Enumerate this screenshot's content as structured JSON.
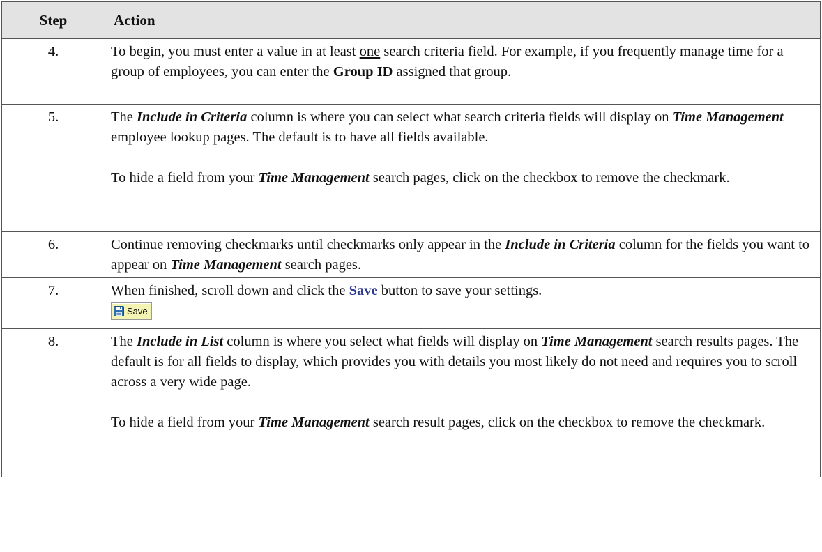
{
  "table": {
    "headers": {
      "step": "Step",
      "action": "Action"
    },
    "rows": [
      {
        "step": "4.",
        "p1": {
          "a": "To begin, you must enter a value in at least ",
          "b": "one",
          "c": " search criteria field. For example, if you frequently manage time for a group of employees, you can enter the ",
          "d": "Group ID",
          "e": " assigned that group."
        }
      },
      {
        "step": "5.",
        "p1": {
          "a": "The ",
          "b": "Include in Criteria",
          "c": " column is where you can select what search criteria fields will display on ",
          "d": "Time Management",
          "e": " employee lookup pages. The default is to have all fields available."
        },
        "p2": {
          "a": "To hide a field from your ",
          "b": "Time Management",
          "c": " search pages, click on the checkbox to remove the checkmark."
        }
      },
      {
        "step": "6.",
        "p1": {
          "a": "Continue removing checkmarks until checkmarks only appear in the ",
          "b": "Include in Criteria",
          "c": " column for the fields you want to appear on ",
          "d": "Time Management",
          "e": " search pages."
        }
      },
      {
        "step": "7.",
        "p1": {
          "a": "When finished, scroll down and click the ",
          "b": "Save",
          "c": " button to save your settings."
        },
        "button_label": "Save"
      },
      {
        "step": "8.",
        "p1": {
          "a": "The ",
          "b": "Include in List",
          "c": " column is where you select what fields will display on ",
          "d": "Time Management",
          "e": " search results pages. The default is for all fields to display, which provides you with details you most likely do not need and requires you to scroll across a very wide page."
        },
        "p2": {
          "a": "To hide a field from your ",
          "b": "Time Management",
          "c": " search result pages, click on the checkbox to remove the checkmark."
        }
      }
    ]
  },
  "colors": {
    "header_bg": "#e3e3e3",
    "border": "#555555",
    "save_link": "#2b3a8f",
    "button_bg": "#f3f3b4"
  },
  "icons": {
    "save": "floppy-disk-icon"
  }
}
